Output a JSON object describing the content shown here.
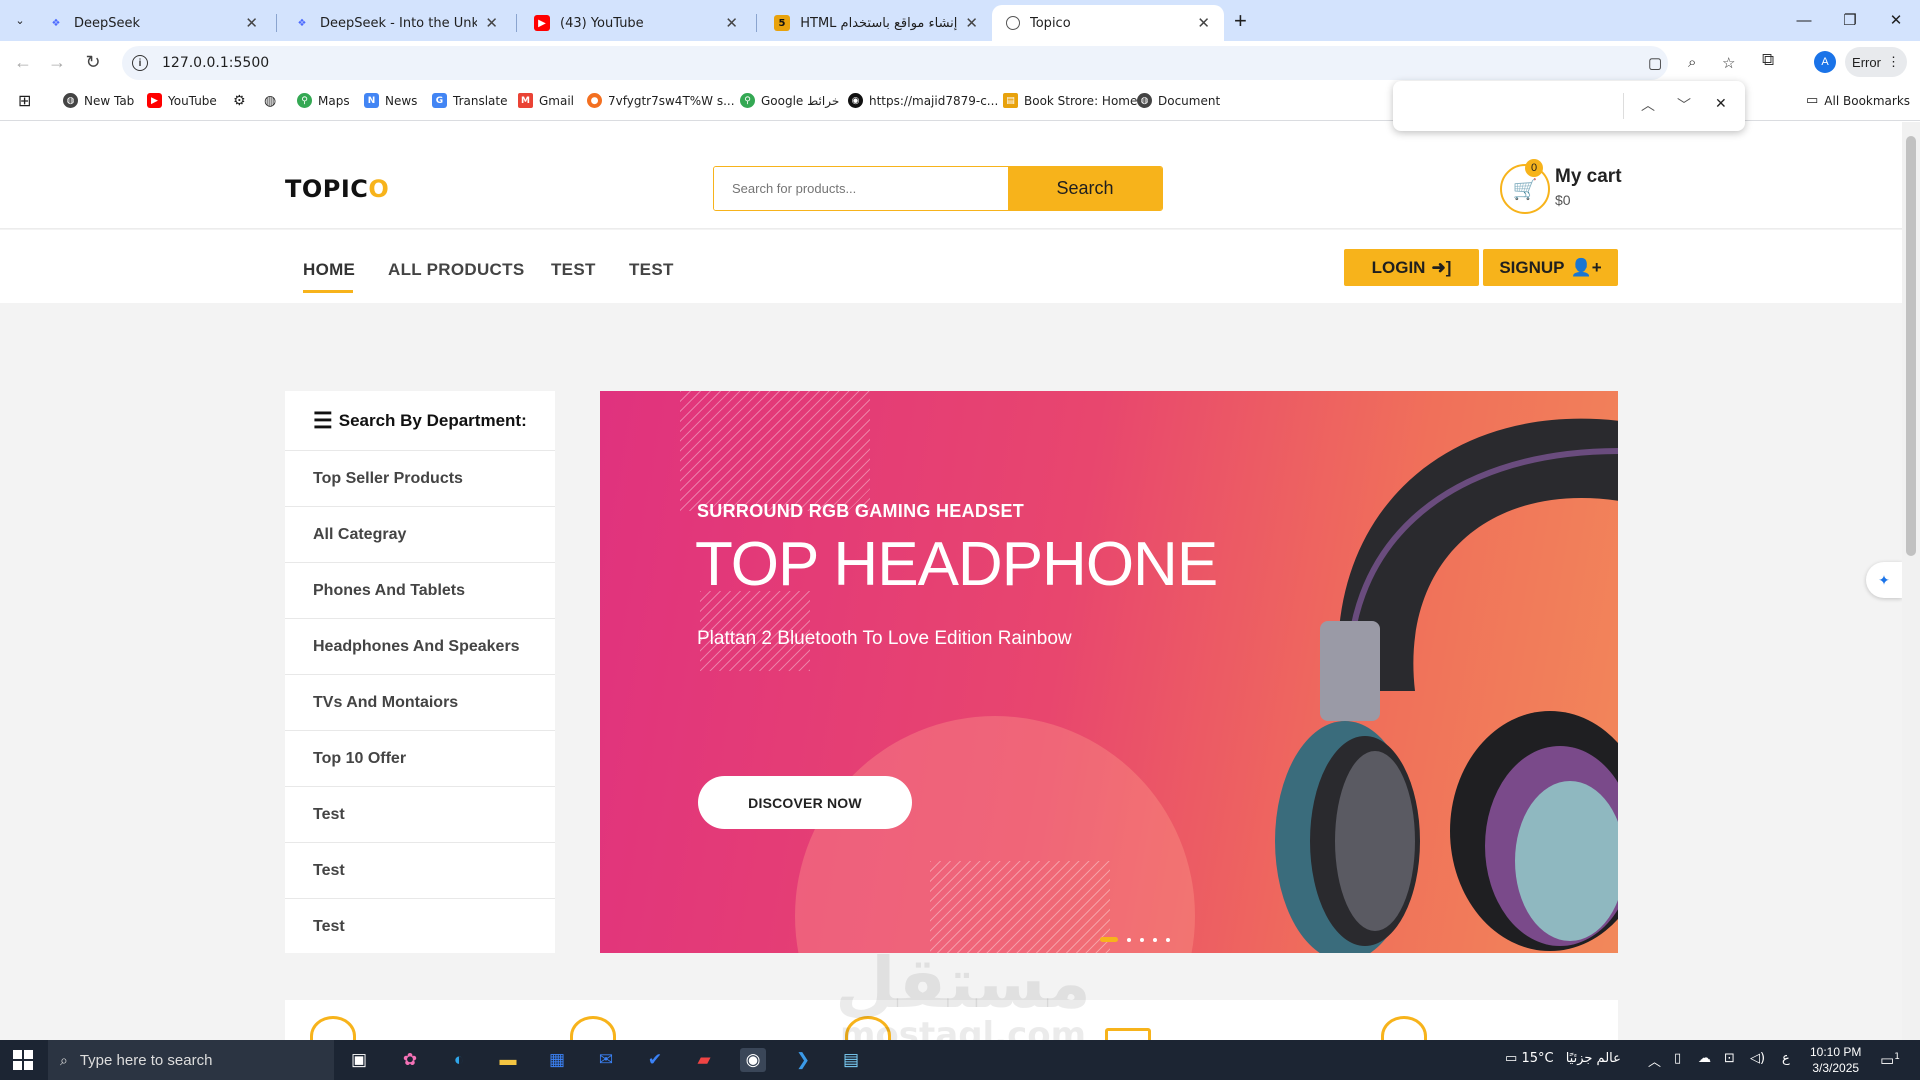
{
  "browser": {
    "tabs": [
      {
        "title": "DeepSeek",
        "active": false
      },
      {
        "title": "DeepSeek - Into the Unknown",
        "active": false
      },
      {
        "title": "(43) YouTube",
        "active": false
      },
      {
        "title": "إنشاء مواقع باستخدام HTML وcss",
        "active": false
      },
      {
        "title": "Topico",
        "active": true
      }
    ],
    "url": "127.0.0.1:5500",
    "profile_initial": "A",
    "error_label": "Error",
    "bookmarks": [
      "New Tab",
      "YouTube",
      "Maps",
      "News",
      "Translate",
      "Gmail",
      "7vfygtr7sw4T%W s...",
      "Google خرائط",
      "https://majid7879-c...",
      "Book Strore: Home",
      "Document"
    ],
    "all_bookmarks": "All Bookmarks"
  },
  "site": {
    "logo_main": "TOPIC",
    "logo_accent": "O",
    "search": {
      "placeholder": "Search for products...",
      "button": "Search"
    },
    "cart": {
      "count": "0",
      "title": "My cart",
      "total": "$0"
    },
    "nav": [
      "HOME",
      "ALL PRODUCTS",
      "TEST",
      "TEST"
    ],
    "login": "LOGIN",
    "signup": "SIGNUP",
    "department": {
      "heading": "Search By Department:",
      "items": [
        "Top Seller Products",
        "All Categray",
        "Phones And Tablets",
        "Headphones And Speakers",
        "TVs And Montaiors",
        "Top 10 Offer",
        "Test",
        "Test",
        "Test"
      ]
    },
    "hero": {
      "subtitle": "SURROUND RGB GAMING HEADSET",
      "title": "TOP HEADPHONE",
      "description": "Plattan 2 Bluetooth To Love Edition Rainbow",
      "button": "DISCOVER NOW"
    }
  },
  "watermark": {
    "arabic": "مستقل",
    "latin": "mostaql.com"
  },
  "taskbar": {
    "search_placeholder": "Type here to search",
    "weather": "15°C",
    "weather_label": "عالم جزئيًا",
    "time": "10:10 PM",
    "date": "3/3/2025",
    "notification_count": "1"
  },
  "colors": {
    "accent": "#f7b31b",
    "hero_start": "#e0327e",
    "hero_end": "#f2885a"
  }
}
